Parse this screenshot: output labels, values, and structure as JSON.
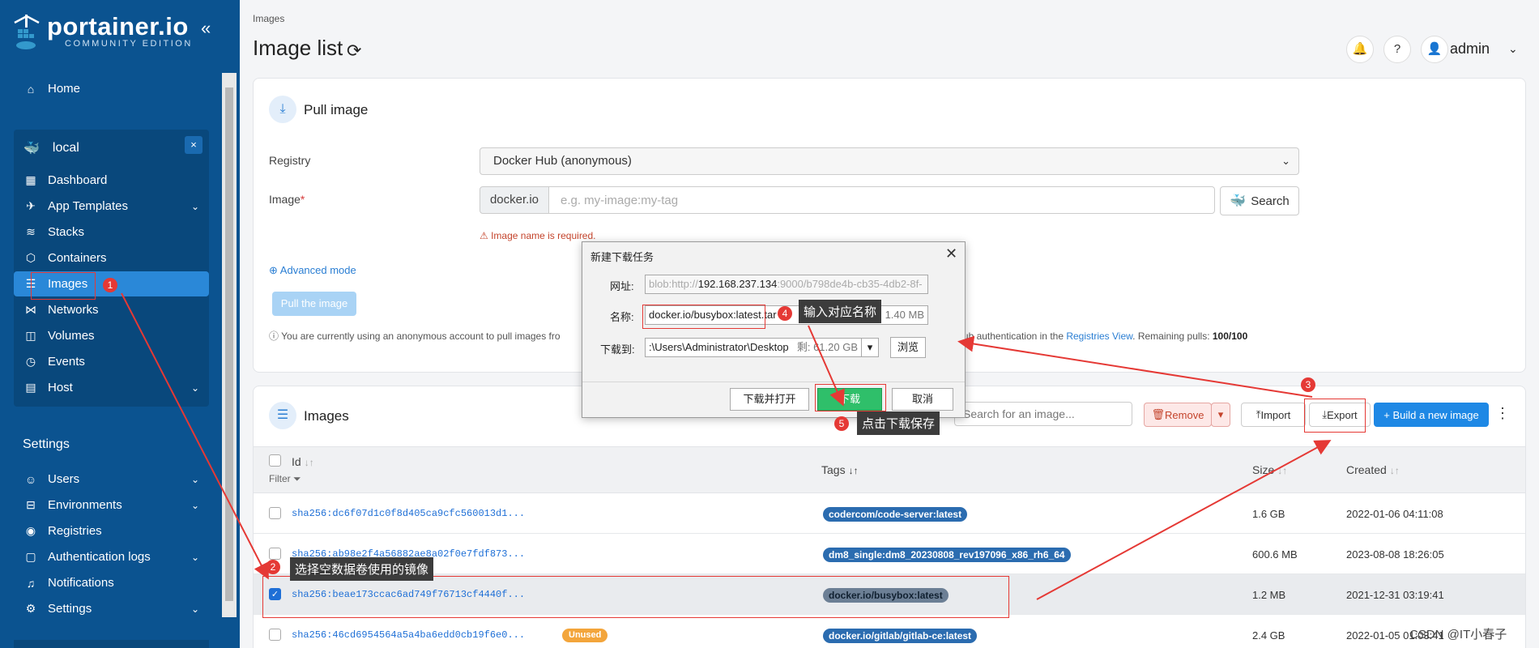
{
  "sidebar": {
    "logo_text": "portainer.io",
    "logo_sub": "COMMUNITY EDITION",
    "home": "Home",
    "environment": "local",
    "env_items": [
      "Dashboard",
      "App Templates",
      "Stacks",
      "Containers",
      "Images",
      "Networks",
      "Volumes",
      "Events",
      "Host"
    ],
    "settings_title": "Settings",
    "settings_items": [
      "Users",
      "Environments",
      "Registries",
      "Authentication logs",
      "Notifications",
      "Settings"
    ]
  },
  "header": {
    "breadcrumb": "Images",
    "title": "Image list",
    "username": "admin"
  },
  "pull": {
    "title": "Pull image",
    "registry_label": "Registry",
    "registry_value": "Docker Hub (anonymous)",
    "image_label": "Image",
    "image_required": "*",
    "prefix": "docker.io",
    "image_placeholder": "e.g. my-image:my-tag",
    "search_label": "Search",
    "error": "Image name is required.",
    "advanced": "Advanced mode",
    "pull_button": "Pull the image",
    "notice_pre": "You are currently using an anonymous account to pull images fro",
    "notice_mid": "erHub authentication in the ",
    "notice_link": "Registries View",
    "notice_post": ". Remaining pulls: ",
    "remaining": "100/100"
  },
  "images": {
    "title": "Images",
    "search_placeholder": "Search for an image...",
    "remove": "Remove",
    "import": "Import",
    "export": "Export",
    "build": "+ Build a new image",
    "columns": {
      "id": "Id",
      "filter": "Filter",
      "tags": "Tags",
      "size": "Size",
      "created": "Created"
    },
    "rows": [
      {
        "id": "sha256:dc6f07d1c0f8d405ca9cfc560013d1...",
        "tag": "codercom/code-server:latest",
        "size": "1.6 GB",
        "created": "2022-01-06 04:11:08",
        "unused": ""
      },
      {
        "id": "sha256:ab98e2f4a56882ae8a02f0e7fdf873...",
        "tag": "dm8_single:dm8_20230808_rev197096_x86_rh6_64",
        "size": "600.6 MB",
        "created": "2023-08-08 18:26:05",
        "unused": ""
      },
      {
        "id": "sha256:beae173ccac6ad749f76713cf4440f...",
        "tag": "docker.io/busybox:latest",
        "size": "1.2 MB",
        "created": "2021-12-31 03:19:41",
        "unused": ""
      },
      {
        "id": "sha256:46cd6954564a5a4ba6edd0cb19f6e0...",
        "tag": "docker.io/gitlab/gitlab-ce:latest",
        "size": "2.4 GB",
        "created": "2022-01-05 01:03:41",
        "unused": "Unused"
      }
    ]
  },
  "dialog": {
    "title": "新建下载任务",
    "url_label": "网址:",
    "url_value_prefix": "blob:http://",
    "url_value_host": "192.168.237.134",
    "url_value_suffix": ":9000/b798de4b-cb35-4db2-8f-",
    "name_label": "名称:",
    "name_value": "docker.io/busybox:latest.tar",
    "name_size": "1.40 MB",
    "saveto_label": "下载到:",
    "saveto_value": ":\\Users\\Administrator\\Desktop",
    "saveto_free": "剩: 61.20 GB",
    "browse": "浏览",
    "download_open": "下载并打开",
    "download": "下载",
    "cancel": "取消"
  },
  "annotations": {
    "n1": "1",
    "n2": "2",
    "n3": "3",
    "n4": "4",
    "n5": "5",
    "c2": "选择空数据卷使用的镜像",
    "c4": "输入对应名称",
    "c5": "点击下载保存"
  },
  "watermark": "CSDN @IT小春子",
  "colors": {
    "sidebar": "#0b5390",
    "active": "#2a88d8",
    "accent": "#1e88e5",
    "annotation": "#e53935"
  }
}
